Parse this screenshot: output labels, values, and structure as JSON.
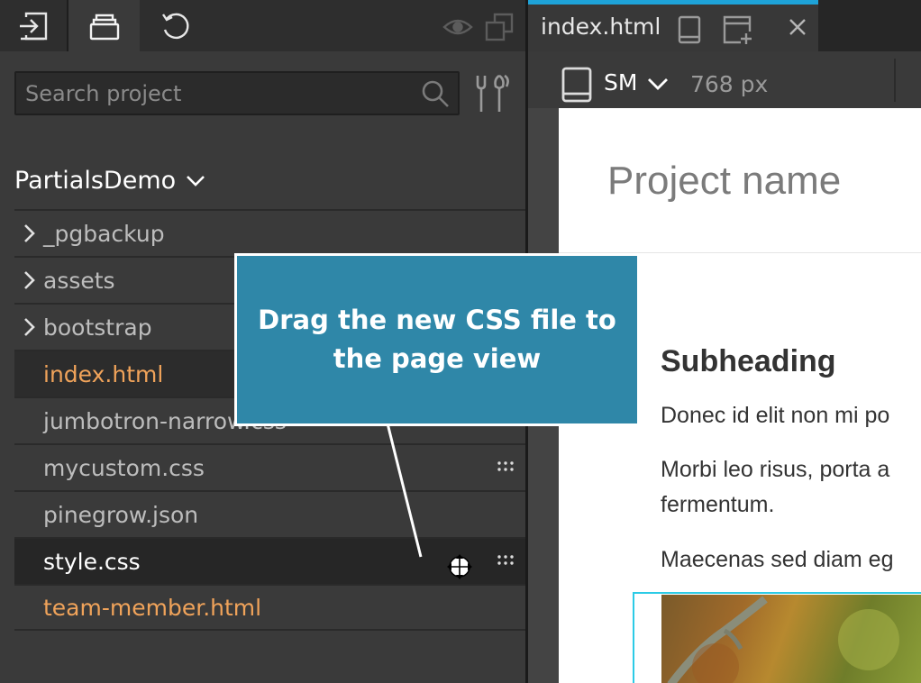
{
  "left_panel": {
    "toolbar": {
      "import_icon": "import-icon",
      "files_icon": "files-stack-icon",
      "history_icon": "undo-history-icon",
      "eye_icon": "eye-icon",
      "copy_icon": "copy-icon"
    },
    "search": {
      "placeholder": "Search project",
      "value": ""
    },
    "project": {
      "name": "PartialsDemo"
    },
    "files": [
      {
        "label": "_pgbackup",
        "type": "folder"
      },
      {
        "label": "assets",
        "type": "folder"
      },
      {
        "label": "bootstrap",
        "type": "folder"
      },
      {
        "label": "index.html",
        "type": "html",
        "state": "active"
      },
      {
        "label": "jumbotron-narrow.css",
        "type": "css"
      },
      {
        "label": "mycustom.css",
        "type": "css"
      },
      {
        "label": "pinegrow.json",
        "type": "json"
      },
      {
        "label": "style.css",
        "type": "css",
        "state": "selected"
      },
      {
        "label": "team-member.html",
        "type": "html"
      }
    ]
  },
  "editor": {
    "tab": {
      "label": "index.html"
    },
    "device": {
      "size": "SM",
      "width": "768 px"
    },
    "page": {
      "project_name": "Project name",
      "subheading": "Subheading",
      "para1": "Donec id elit non mi po",
      "para2_line1": "Morbi leo risus, porta a",
      "para2_line2": "fermentum.",
      "para3": "Maecenas sed diam eg"
    }
  },
  "tooltip": {
    "text": "Drag the new CSS file to the page view"
  },
  "colors": {
    "accent": "#1ea3d8",
    "tooltip_bg": "#2f87a8",
    "html_file": "#f0a35a",
    "panel_bg": "#3a3a3a"
  }
}
